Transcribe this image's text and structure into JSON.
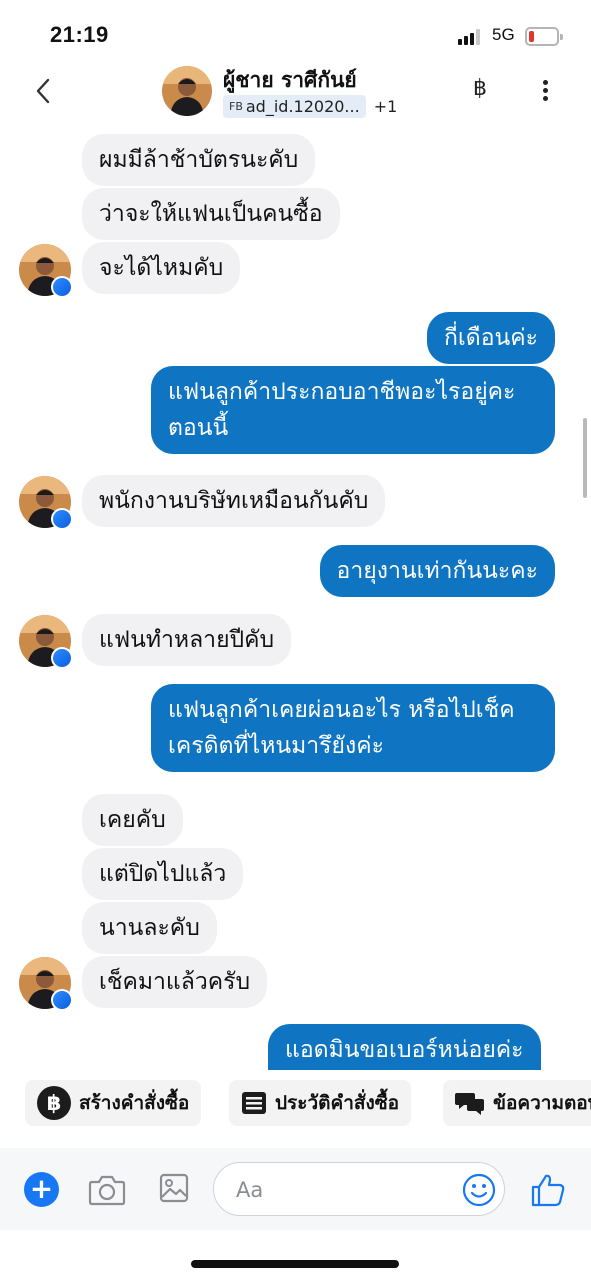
{
  "status_bar": {
    "time": "21:19",
    "network": "5G",
    "battery_color": "#e3342f"
  },
  "header": {
    "contact_name": "ผู้ชาย ราศีกันย์",
    "source_badge": "FB",
    "ad_label": "ad_id.12020...",
    "extra_count": "+1",
    "currency_icon": "baht-icon",
    "back_icon": "chevron-left-icon",
    "more_icon": "more-vertical-icon"
  },
  "messages": [
    {
      "from": "contact",
      "text": "ผมมีล้าช้าบัตรนะคับ"
    },
    {
      "from": "contact",
      "text": "ว่าจะให้แฟนเป็นคนซื้อ"
    },
    {
      "from": "contact",
      "text": "จะได้ไหมคับ"
    },
    {
      "from": "me",
      "text": "กี่เดือนค่ะ"
    },
    {
      "from": "me",
      "line1": "แฟนลูกค้าประกอบอาชีพอะไรอยู่คะ",
      "line2": "ตอนนี้"
    },
    {
      "from": "contact",
      "text": "พนักงานบริษัทเหมือนกันคับ"
    },
    {
      "from": "me",
      "text": "อายุงานเท่ากันนะคะ"
    },
    {
      "from": "contact",
      "text": "แฟนทำหลายปีคับ"
    },
    {
      "from": "me",
      "line1": "แฟนลูกค้าเคยผ่อนอะไร หรือไปเช็ค",
      "line2": "เครดิตที่ไหนมารึยังค่ะ"
    },
    {
      "from": "contact",
      "text": "เคยคับ"
    },
    {
      "from": "contact",
      "text": "แต่ปิดไปแล้ว"
    },
    {
      "from": "contact",
      "text": "นานละคับ"
    },
    {
      "from": "contact",
      "text": "เช็คมาแล้วครับ"
    },
    {
      "from": "me",
      "text": "แอดมินขอเบอร์หน่อยค่ะ"
    }
  ],
  "quick_actions": [
    {
      "label": "สร้างคำสั่งซื้อ",
      "icon": "baht-circle-icon"
    },
    {
      "label": "ประวัติคำสั่งซื้อ",
      "icon": "order-list-icon"
    },
    {
      "label": "ข้อความตอบกลับ",
      "icon": "chat-bubbles-icon"
    }
  ],
  "composer": {
    "placeholder": "Aa",
    "add_icon": "plus-icon",
    "camera_icon": "camera-icon",
    "gallery_icon": "image-icon",
    "emoji_icon": "smiley-icon",
    "like_icon": "thumbs-up-icon"
  },
  "colors": {
    "outgoing_bubble": "#0f74c1",
    "incoming_bubble": "#f1f1f3",
    "accent": "#1877f2"
  }
}
